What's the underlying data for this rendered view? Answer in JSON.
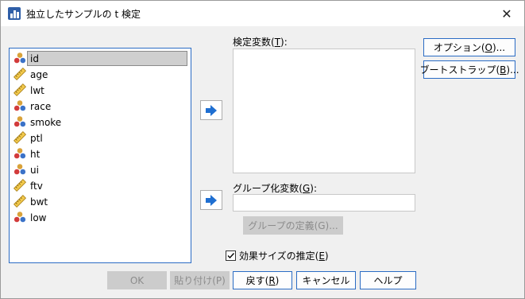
{
  "window": {
    "title": "独立したサンプルの t 検定",
    "close_symbol": "✕"
  },
  "variables": [
    {
      "name": "id",
      "type": "nominal",
      "selected": true
    },
    {
      "name": "age",
      "type": "scale"
    },
    {
      "name": "lwt",
      "type": "scale"
    },
    {
      "name": "race",
      "type": "nominal"
    },
    {
      "name": "smoke",
      "type": "nominal"
    },
    {
      "name": "ptl",
      "type": "scale"
    },
    {
      "name": "ht",
      "type": "nominal"
    },
    {
      "name": "ui",
      "type": "nominal"
    },
    {
      "name": "ftv",
      "type": "scale"
    },
    {
      "name": "bwt",
      "type": "scale"
    },
    {
      "name": "low",
      "type": "nominal"
    }
  ],
  "test_variables": {
    "label": "検定変数(",
    "mnemonic": "T",
    "label_end": "):"
  },
  "grouping_variable": {
    "label": "グループ化変数(",
    "mnemonic": "G",
    "label_end": "):",
    "value": ""
  },
  "define_groups_button": "グループの定義(G)...",
  "side_buttons": {
    "options": {
      "label": "オプション(",
      "mnemonic": "O",
      "end": ")..."
    },
    "bootstrap": {
      "label": "ブートストラップ(",
      "mnemonic": "B",
      "end": ")..."
    }
  },
  "effect_size": {
    "label": "効果サイズの推定(",
    "mnemonic": "E",
    "end": ")",
    "checked": true
  },
  "bottom_buttons": {
    "ok": "OK",
    "paste": "貼り付け(P)",
    "reset": {
      "label": "戻す(",
      "mnemonic": "R",
      "end": ")"
    },
    "cancel": "キャンセル",
    "help": "ヘルプ"
  }
}
